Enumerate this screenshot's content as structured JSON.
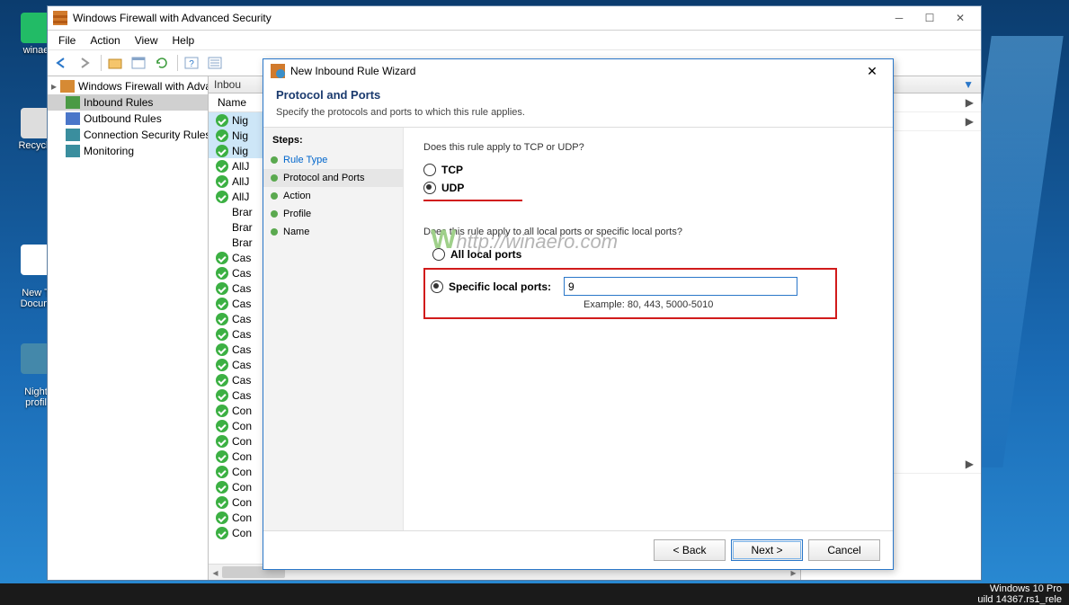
{
  "desktop": {
    "icons": [
      {
        "label": "winae"
      },
      {
        "label": "Recycle"
      },
      {
        "label": "New T\nDocum"
      },
      {
        "label": "Night\nprofil"
      }
    ],
    "taskbar_line1": "Windows 10 Pro",
    "taskbar_line2": "uild 14367.rs1_rele"
  },
  "window": {
    "title": "Windows Firewall with Advanced Security",
    "menu": [
      "File",
      "Action",
      "View",
      "Help"
    ],
    "tree": [
      {
        "label": "Windows Firewall with Advance",
        "icon": "shield",
        "indent": 0
      },
      {
        "label": "Inbound Rules",
        "icon": "in",
        "indent": 1,
        "sel": true
      },
      {
        "label": "Outbound Rules",
        "icon": "out",
        "indent": 1
      },
      {
        "label": "Connection Security Rules",
        "icon": "conn",
        "indent": 1
      },
      {
        "label": "Monitoring",
        "icon": "mon",
        "indent": 1
      }
    ],
    "mid_header": "Inbou",
    "list_header": "Name",
    "rules": [
      {
        "n": "Nig",
        "hl": true
      },
      {
        "n": "Nig",
        "hl": true
      },
      {
        "n": "Nig",
        "hl": true
      },
      {
        "n": "AllJ"
      },
      {
        "n": "AllJ"
      },
      {
        "n": "AllJ"
      },
      {
        "n": "Brar",
        "no": true
      },
      {
        "n": "Brar",
        "no": true
      },
      {
        "n": "Brar",
        "no": true
      },
      {
        "n": "Cas"
      },
      {
        "n": "Cas"
      },
      {
        "n": "Cas"
      },
      {
        "n": "Cas"
      },
      {
        "n": "Cas"
      },
      {
        "n": "Cas"
      },
      {
        "n": "Cas"
      },
      {
        "n": "Cas"
      },
      {
        "n": "Cas"
      },
      {
        "n": "Cas"
      },
      {
        "n": "Con"
      },
      {
        "n": "Con"
      },
      {
        "n": "Con"
      },
      {
        "n": "Con"
      },
      {
        "n": "Con"
      },
      {
        "n": "Con"
      },
      {
        "n": "Con"
      },
      {
        "n": "Con"
      },
      {
        "n": "Con"
      }
    ],
    "action_header": " "
  },
  "dialog": {
    "title": "New Inbound Rule Wizard",
    "heading": "Protocol and Ports",
    "subheading": "Specify the protocols and ports to which this rule applies.",
    "steps_label": "Steps:",
    "steps": [
      {
        "label": "Rule Type",
        "link": true
      },
      {
        "label": "Protocol and Ports",
        "active": true
      },
      {
        "label": "Action"
      },
      {
        "label": "Profile"
      },
      {
        "label": "Name"
      }
    ],
    "q1": "Does this rule apply to TCP or UDP?",
    "proto": [
      {
        "label": "TCP",
        "sel": false
      },
      {
        "label": "UDP",
        "sel": true
      }
    ],
    "q2": "Does this rule apply to all local ports or specific local ports?",
    "port_opts": [
      {
        "label": "All local ports",
        "sel": false
      },
      {
        "label": "Specific local ports:",
        "sel": true
      }
    ],
    "port_value": "9",
    "example": "Example: 80, 443, 5000-5010",
    "buttons": {
      "back": "< Back",
      "next": "Next >",
      "cancel": "Cancel"
    }
  }
}
